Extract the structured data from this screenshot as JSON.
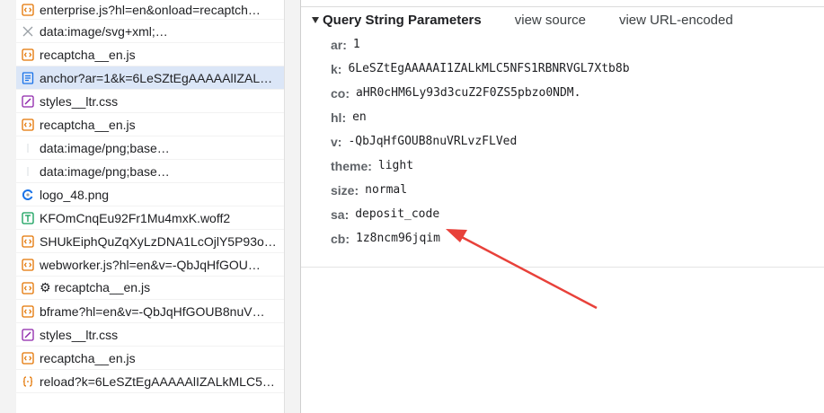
{
  "file_list": [
    {
      "name": "enterprise.js?hl=en&onload=recaptch…",
      "icon": "script-icon"
    },
    {
      "name": "data:image/svg+xml;…",
      "icon": "svg-icon"
    },
    {
      "name": "recaptcha__en.js",
      "icon": "script-icon"
    },
    {
      "name": "anchor?ar=1&k=6LeSZtEgAAAAAlIZAL…",
      "icon": "document-icon"
    },
    {
      "name": "styles__ltr.css",
      "icon": "stylesheet-icon"
    },
    {
      "name": "recaptcha__en.js",
      "icon": "script-icon"
    },
    {
      "name": "data:image/png;base…",
      "icon": "image-icon"
    },
    {
      "name": "data:image/png;base…",
      "icon": "image-icon"
    },
    {
      "name": "logo_48.png",
      "icon": "recaptcha-logo-icon"
    },
    {
      "name": "KFOmCnqEu92Fr1Mu4mxK.woff2",
      "icon": "font-icon"
    },
    {
      "name": "SHUkEiphQuZqXyLzDNA1LcOjlY5P93o…",
      "icon": "script-icon"
    },
    {
      "name": "webworker.js?hl=en&v=-QbJqHfGOU…",
      "icon": "script-icon"
    },
    {
      "name": "⚙ recaptcha__en.js",
      "icon": "script-icon"
    },
    {
      "name": "bframe?hl=en&v=-QbJqHfGOUB8nuV…",
      "icon": "script-icon"
    },
    {
      "name": "styles__ltr.css",
      "icon": "stylesheet-icon"
    },
    {
      "name": "recaptcha__en.js",
      "icon": "script-icon"
    },
    {
      "name": "reload?k=6LeSZtEgAAAAAlIZALkMLC5…",
      "icon": "json-icon"
    }
  ],
  "selected_index": 3,
  "query_section": {
    "title": "Query String Parameters",
    "view_source": "view source",
    "view_url_encoded": "view URL-encoded",
    "params": [
      {
        "key": "ar:",
        "value": "1"
      },
      {
        "key": "k:",
        "value": "6LeSZtEgAAAAAI1ZALkMLC5NFS1RBNRVGL7Xtb8b"
      },
      {
        "key": "co:",
        "value": "aHR0cHM6Ly93d3cuZ2F0ZS5pbzo0NDM."
      },
      {
        "key": "hl:",
        "value": "en"
      },
      {
        "key": "v:",
        "value": "-QbJqHfGOUB8nuVRLvzFLVed"
      },
      {
        "key": "theme:",
        "value": "light"
      },
      {
        "key": "size:",
        "value": "normal"
      },
      {
        "key": "sa:",
        "value": "deposit_code"
      },
      {
        "key": "cb:",
        "value": "1z8ncm96jqim"
      }
    ]
  },
  "colors": {
    "selected_row": "#dbe6f7",
    "annotation_arrow": "#e8413a",
    "script_icon": "#e37400",
    "document_icon": "#1a73e8",
    "stylesheet_icon": "#8e24aa"
  }
}
